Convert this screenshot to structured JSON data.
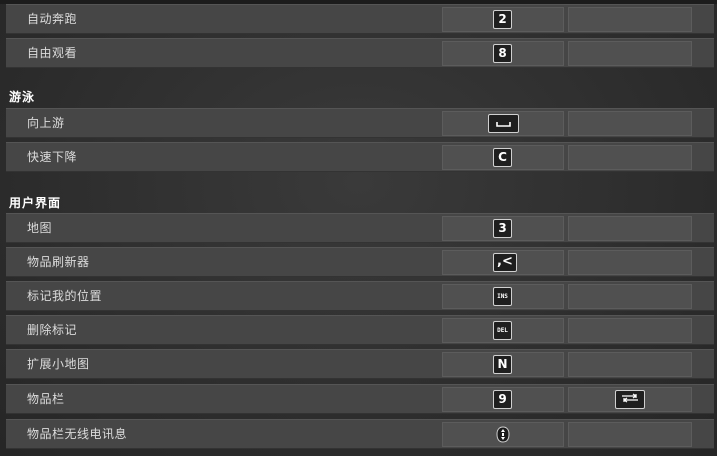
{
  "sections": [
    {
      "header": "",
      "rows": [
        {
          "label": "自动奔跑",
          "primary": "2",
          "secondary": ""
        },
        {
          "label": "自由观看",
          "primary": "8",
          "secondary": ""
        }
      ]
    },
    {
      "header": "游泳",
      "rows": [
        {
          "label": "向上游",
          "primary": "space-icon",
          "secondary": ""
        },
        {
          "label": "快速下降",
          "primary": "C",
          "secondary": ""
        }
      ]
    },
    {
      "header": "用户界面",
      "rows": [
        {
          "label": "地图",
          "primary": "3",
          "secondary": ""
        },
        {
          "label": "物品刷新器",
          "primary": ",<",
          "secondary": ""
        },
        {
          "label": "标记我的位置",
          "primary": "INS",
          "secondary": ""
        },
        {
          "label": "删除标记",
          "primary": "DEL",
          "secondary": ""
        },
        {
          "label": "扩展小地图",
          "primary": "N",
          "secondary": ""
        },
        {
          "label": "物品栏",
          "primary": "9",
          "secondary": "tab-icon"
        },
        {
          "label": "物品栏无线电讯息",
          "primary": "mouse-middle-icon",
          "secondary": ""
        }
      ]
    }
  ]
}
